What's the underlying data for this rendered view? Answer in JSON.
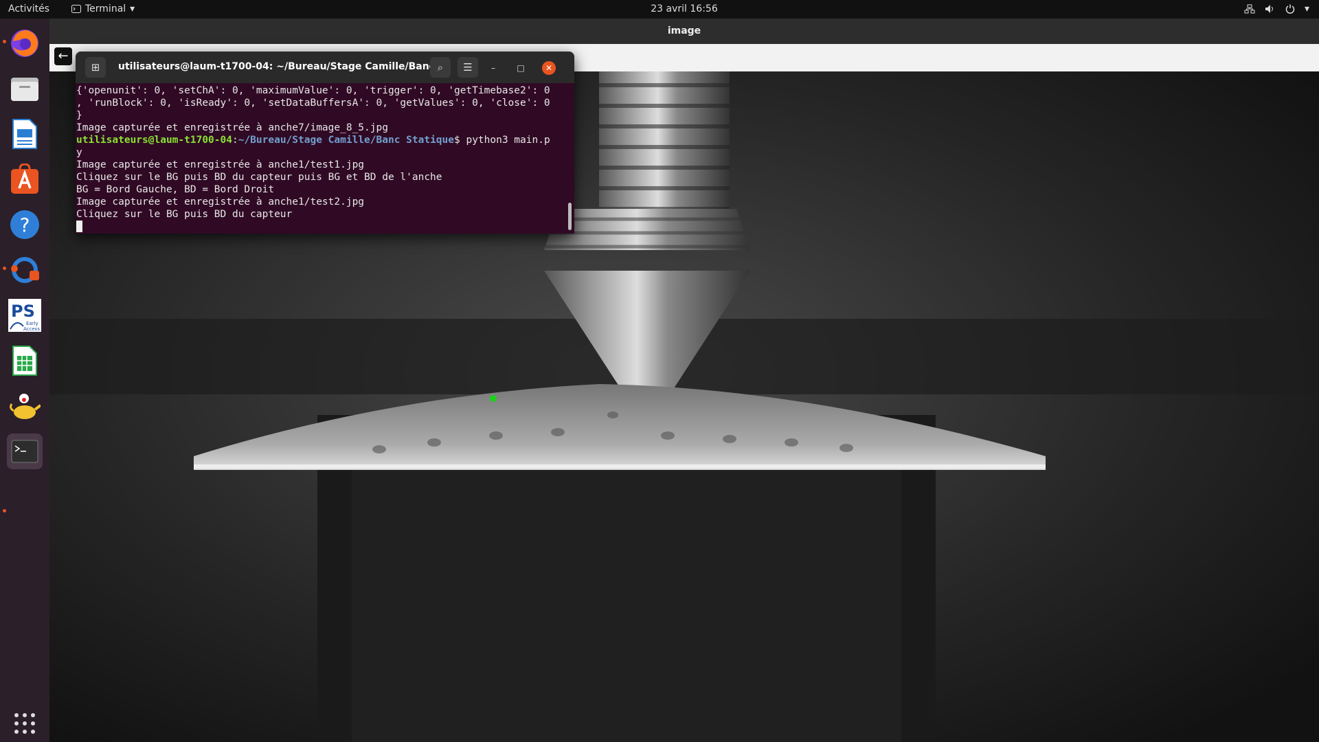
{
  "topbar": {
    "activities": "Activités",
    "app_name": "Terminal",
    "clock": "23 avril  16:56"
  },
  "dock": {
    "items": [
      "firefox-icon",
      "files-icon",
      "writer-icon",
      "software-icon",
      "help-icon",
      "updater-icon",
      "ps-early-access-icon",
      "calc-icon",
      "genie-icon",
      "terminal-icon"
    ],
    "ps_label": "PS",
    "ps_sub": "Early Access"
  },
  "image_window": {
    "title": "image"
  },
  "terminal": {
    "title": "utilisateurs@laum-t1700-04: ~/Bureau/Stage Camille/Banc ...",
    "lines": [
      "{'openunit': 0, 'setChA': 0, 'maximumValue': 0, 'trigger': 0, 'getTimebase2': 0",
      ", 'runBlock': 0, 'isReady': 0, 'setDataBuffersA': 0, 'getValues': 0, 'close': 0",
      "}",
      "Image capturée et enregistrée à anche7/image_8_5.jpg"
    ],
    "prompt_user": "utilisateurs@laum-t1700-04",
    "prompt_colon": ":",
    "prompt_path": "~/Bureau/Stage Camille/Banc Statique",
    "prompt_cmd": "$ python3 main.p",
    "prompt_wrap": "y",
    "lines_after": [
      "Image capturée et enregistrée à anche1/test1.jpg",
      "Cliquez sur le BG puis BD du capteur puis BG et BD de l'anche",
      "BG = Bord Gauche, BD = Bord Droit",
      "Image capturée et enregistrée à anche1/test2.jpg",
      "Cliquez sur le BG puis BD du capteur"
    ]
  },
  "colors": {
    "accent": "#e95420",
    "terminal_bg": "#300a24",
    "prompt_user": "#8ae234",
    "prompt_path": "#729fcf"
  }
}
